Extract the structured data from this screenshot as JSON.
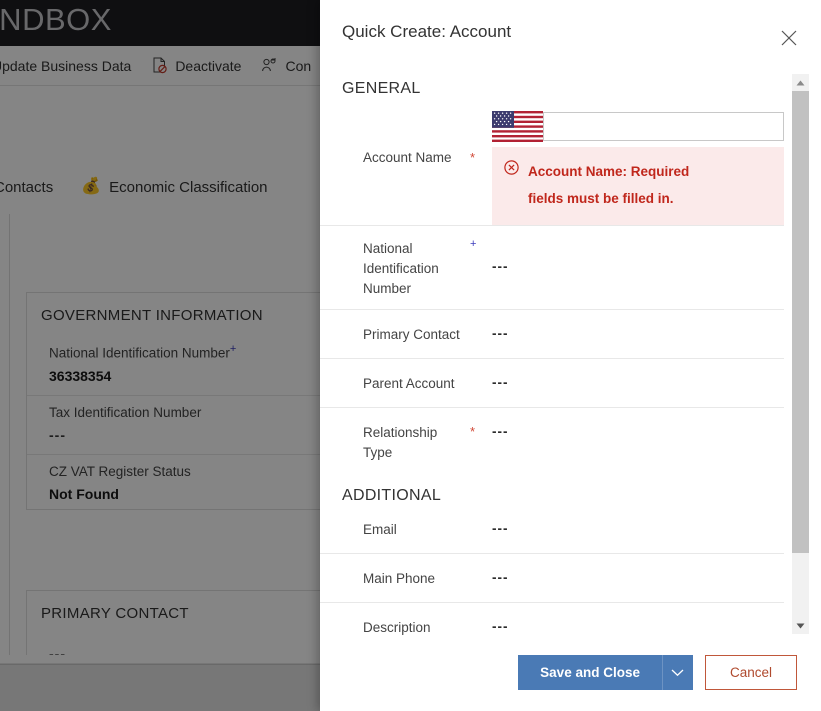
{
  "background": {
    "topbar_title": "ANDBOX",
    "command_bar": [
      {
        "label": "Update Business Data",
        "icon": "none"
      },
      {
        "label": "Deactivate",
        "icon": "deactivate-icon"
      },
      {
        "label": "Con",
        "icon": "connect-people-icon"
      }
    ],
    "tabs": [
      {
        "label": "Contacts",
        "icon": "none"
      },
      {
        "label": "Economic Classification",
        "icon": "money-bag-icon"
      }
    ],
    "cards": [
      {
        "title": "GOVERNMENT INFORMATION",
        "fields": [
          {
            "label": "National Identification Number",
            "required_mark": "+",
            "value": "36338354"
          },
          {
            "label": "Tax Identification Number",
            "required_mark": "",
            "value": "---"
          },
          {
            "label": "CZ VAT Register Status",
            "required_mark": "",
            "value": "Not Found"
          }
        ]
      },
      {
        "title": "PRIMARY CONTACT",
        "fields": [
          {
            "label": "",
            "required_mark": "",
            "value": "---"
          }
        ]
      }
    ]
  },
  "panel": {
    "title": "Quick Create: Account",
    "close_icon": "close-icon",
    "sections": [
      {
        "heading": "GENERAL",
        "fields": [
          {
            "label": "Account Name",
            "required": "*",
            "required_color": "#d14836",
            "type": "text-with-flag",
            "flag_icon": "us-flag-icon",
            "value": "",
            "placeholder": "",
            "error_icon": "error-circle-x-icon",
            "error_text": "Account Name: Required fields must be filled in."
          },
          {
            "label": "National Identification Number",
            "required": "+",
            "required_color": "#3b3bbb",
            "type": "text",
            "value": "---"
          },
          {
            "label": "Primary Contact",
            "required": "",
            "required_color": "",
            "type": "lookup",
            "value": "---"
          },
          {
            "label": "Parent Account",
            "required": "",
            "required_color": "",
            "type": "lookup",
            "value": "---"
          },
          {
            "label": "Relationship Type",
            "required": "*",
            "required_color": "#d14836",
            "type": "optionset",
            "value": "---"
          }
        ]
      },
      {
        "heading": "ADDITIONAL",
        "fields": [
          {
            "label": "Email",
            "required": "",
            "required_color": "",
            "type": "text",
            "value": "---"
          },
          {
            "label": "Main Phone",
            "required": "",
            "required_color": "",
            "type": "text",
            "value": "---"
          },
          {
            "label": "Description",
            "required": "",
            "required_color": "",
            "type": "text",
            "value": "---"
          }
        ]
      }
    ],
    "scrollbar": {
      "up_icon": "scroll-up-arrow-icon",
      "down_icon": "scroll-down-arrow-icon"
    },
    "footer": {
      "save_label": "Save and Close",
      "save_caret_icon": "chevron-down-icon",
      "cancel_label": "Cancel"
    }
  },
  "colors": {
    "primary_button": "#4a7ab5",
    "cancel_border": "#c0573a",
    "error_text": "#c0271c",
    "error_bg": "#fbeaea",
    "required_red": "#d14836",
    "required_blue": "#3b3bbb",
    "topbar_bg": "#1e1e22"
  }
}
